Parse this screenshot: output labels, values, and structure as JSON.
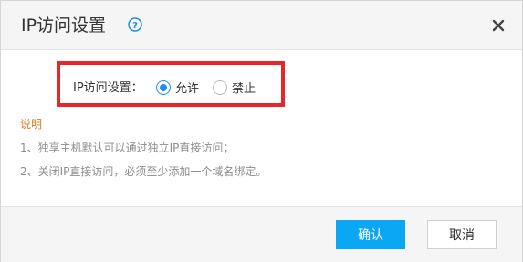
{
  "dialog": {
    "title": "IP访问设置",
    "help_icon": "question-circle-icon",
    "close_icon": "close-x-icon"
  },
  "setting": {
    "label": "IP访问设置：",
    "options": [
      {
        "label": "允许",
        "checked": true
      },
      {
        "label": "禁止",
        "checked": false
      }
    ],
    "highlight_color": "#e8262a"
  },
  "notes": {
    "title": "说明",
    "lines": [
      "1、独享主机默认可以通过独立IP直接访问；",
      "2、关闭IP直接访问，必须至少添加一个域名绑定。"
    ]
  },
  "footer": {
    "confirm_label": "确认",
    "cancel_label": "取消"
  },
  "colors": {
    "accent": "#1e8fe6",
    "confirm_bg": "#0aa7f5",
    "note_title": "#e07b1f"
  }
}
